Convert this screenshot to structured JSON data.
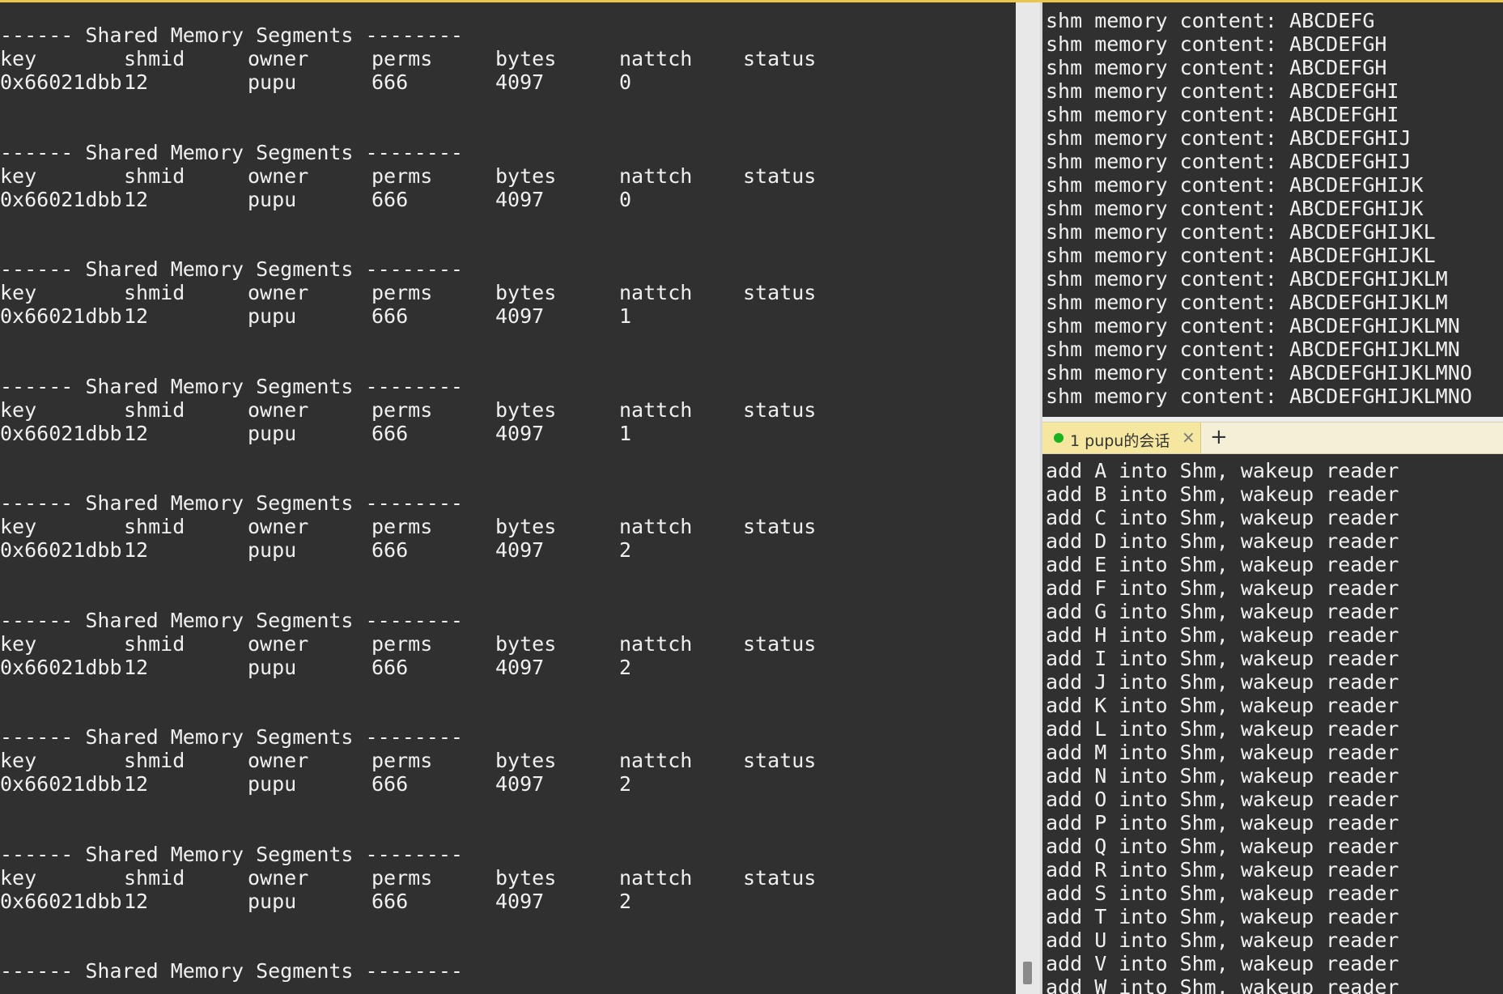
{
  "left_terminal": {
    "header_text": "------ Shared Memory Segments --------",
    "columns": [
      "key",
      "shmid",
      "owner",
      "perms",
      "bytes",
      "nattch",
      "status"
    ],
    "segments": [
      {
        "key": "0x66021dbb",
        "shmid": "12",
        "owner": "pupu",
        "perms": "666",
        "bytes": "4097",
        "nattch": "0",
        "status": ""
      },
      {
        "key": "0x66021dbb",
        "shmid": "12",
        "owner": "pupu",
        "perms": "666",
        "bytes": "4097",
        "nattch": "0",
        "status": ""
      },
      {
        "key": "0x66021dbb",
        "shmid": "12",
        "owner": "pupu",
        "perms": "666",
        "bytes": "4097",
        "nattch": "1",
        "status": ""
      },
      {
        "key": "0x66021dbb",
        "shmid": "12",
        "owner": "pupu",
        "perms": "666",
        "bytes": "4097",
        "nattch": "1",
        "status": ""
      },
      {
        "key": "0x66021dbb",
        "shmid": "12",
        "owner": "pupu",
        "perms": "666",
        "bytes": "4097",
        "nattch": "2",
        "status": ""
      },
      {
        "key": "0x66021dbb",
        "shmid": "12",
        "owner": "pupu",
        "perms": "666",
        "bytes": "4097",
        "nattch": "2",
        "status": ""
      },
      {
        "key": "0x66021dbb",
        "shmid": "12",
        "owner": "pupu",
        "perms": "666",
        "bytes": "4097",
        "nattch": "2",
        "status": ""
      },
      {
        "key": "0x66021dbb",
        "shmid": "12",
        "owner": "pupu",
        "perms": "666",
        "bytes": "4097",
        "nattch": "2",
        "status": ""
      }
    ]
  },
  "right_top_terminal": {
    "lines": [
      "shm memory content: ABCDEFG",
      "shm memory content: ABCDEFGH",
      "shm memory content: ABCDEFGH",
      "shm memory content: ABCDEFGHI",
      "shm memory content: ABCDEFGHI",
      "shm memory content: ABCDEFGHIJ",
      "shm memory content: ABCDEFGHIJ",
      "shm memory content: ABCDEFGHIJK",
      "shm memory content: ABCDEFGHIJK",
      "shm memory content: ABCDEFGHIJKL",
      "shm memory content: ABCDEFGHIJKL",
      "shm memory content: ABCDEFGHIJKLM",
      "shm memory content: ABCDEFGHIJKLM",
      "shm memory content: ABCDEFGHIJKLMN",
      "shm memory content: ABCDEFGHIJKLMN",
      "shm memory content: ABCDEFGHIJKLMNO",
      "shm memory content: ABCDEFGHIJKLMNO"
    ]
  },
  "session_tab": {
    "label": "1 pupu的会话",
    "close_glyph": "×",
    "add_glyph": "+",
    "status_color": "#19b31e"
  },
  "right_bottom_terminal": {
    "lines": [
      "add A into Shm, wakeup reader",
      "add B into Shm, wakeup reader",
      "add C into Shm, wakeup reader",
      "add D into Shm, wakeup reader",
      "add E into Shm, wakeup reader",
      "add F into Shm, wakeup reader",
      "add G into Shm, wakeup reader",
      "add H into Shm, wakeup reader",
      "add I into Shm, wakeup reader",
      "add J into Shm, wakeup reader",
      "add K into Shm, wakeup reader",
      "add L into Shm, wakeup reader",
      "add M into Shm, wakeup reader",
      "add N into Shm, wakeup reader",
      "add O into Shm, wakeup reader",
      "add P into Shm, wakeup reader",
      "add Q into Shm, wakeup reader",
      "add R into Shm, wakeup reader",
      "add S into Shm, wakeup reader",
      "add T into Shm, wakeup reader",
      "add U into Shm, wakeup reader",
      "add V into Shm, wakeup reader",
      "add W into Shm, wakeup reader"
    ]
  }
}
